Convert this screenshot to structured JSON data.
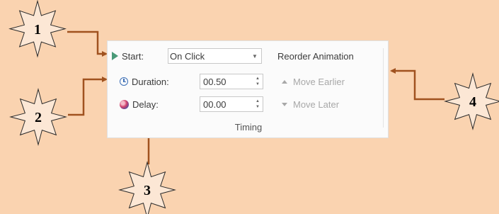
{
  "timing": {
    "start": {
      "label": "Start:",
      "value": "On Click"
    },
    "duration": {
      "label": "Duration:",
      "value": "00.50"
    },
    "delay": {
      "label": "Delay:",
      "value": "00.00"
    },
    "group_label": "Timing"
  },
  "reorder": {
    "title": "Reorder Animation",
    "move_earlier": "Move Earlier",
    "move_later": "Move Later"
  },
  "callouts": [
    "1",
    "2",
    "3",
    "4"
  ],
  "colors": {
    "background": "#fad3b0",
    "arrow": "#a0521f",
    "play_icon": "#4a9a78",
    "clock_icon": "#3d6fb6"
  },
  "icons": {
    "start": "play-icon",
    "duration": "clock-icon",
    "delay": "delay-icon",
    "move_earlier": "triangle-up-icon",
    "move_later": "triangle-down-icon"
  }
}
